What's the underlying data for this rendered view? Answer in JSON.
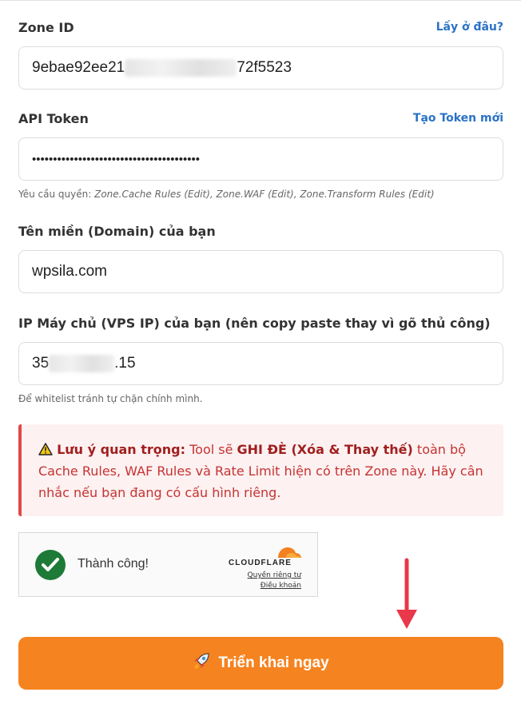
{
  "zone": {
    "label": "Zone ID",
    "help_link": "Lấy ở đâu?",
    "value_start": "9ebae92ee21",
    "value_end": "72f5523"
  },
  "token": {
    "label": "API Token",
    "help_link": "Tạo Token mới",
    "value": "••••••••••••••••••••••••••••••••••••••••",
    "hint_prefix": "Yêu cầu quyền: ",
    "hint_perms": "Zone.Cache Rules (Edit), Zone.WAF (Edit), Zone.Transform Rules (Edit)"
  },
  "domain": {
    "label": "Tên miền (Domain) của bạn",
    "value": "wpsila.com"
  },
  "ip": {
    "label": "IP Máy chủ (VPS IP) của bạn (nên copy paste thay vì gõ thủ công)",
    "value_start": "35",
    "value_end": ".15",
    "hint": "Để whitelist tránh tự chặn chính mình."
  },
  "warning": {
    "icon": "warning-triangle-icon",
    "title": "Lưu ý quan trọng:",
    "text1": " Tool sẽ ",
    "bold": "GHI ĐÈ (Xóa & Thay thế)",
    "text2": " toàn bộ Cache Rules, WAF Rules và Rate Limit hiện có trên Zone này. Hãy cân nhắc nếu bạn đang có cấu hình riêng."
  },
  "captcha": {
    "status": "Thành công!",
    "brand": "CLOUDFLARE",
    "privacy": "Quyền riêng tư",
    "terms": "Điều khoản"
  },
  "deploy": {
    "icon": "rocket-icon",
    "label": "Triển khai ngay"
  },
  "colors": {
    "accent": "#f5831f",
    "link": "#2a72c6",
    "warning": "#e04848",
    "success": "#1e7a37"
  }
}
